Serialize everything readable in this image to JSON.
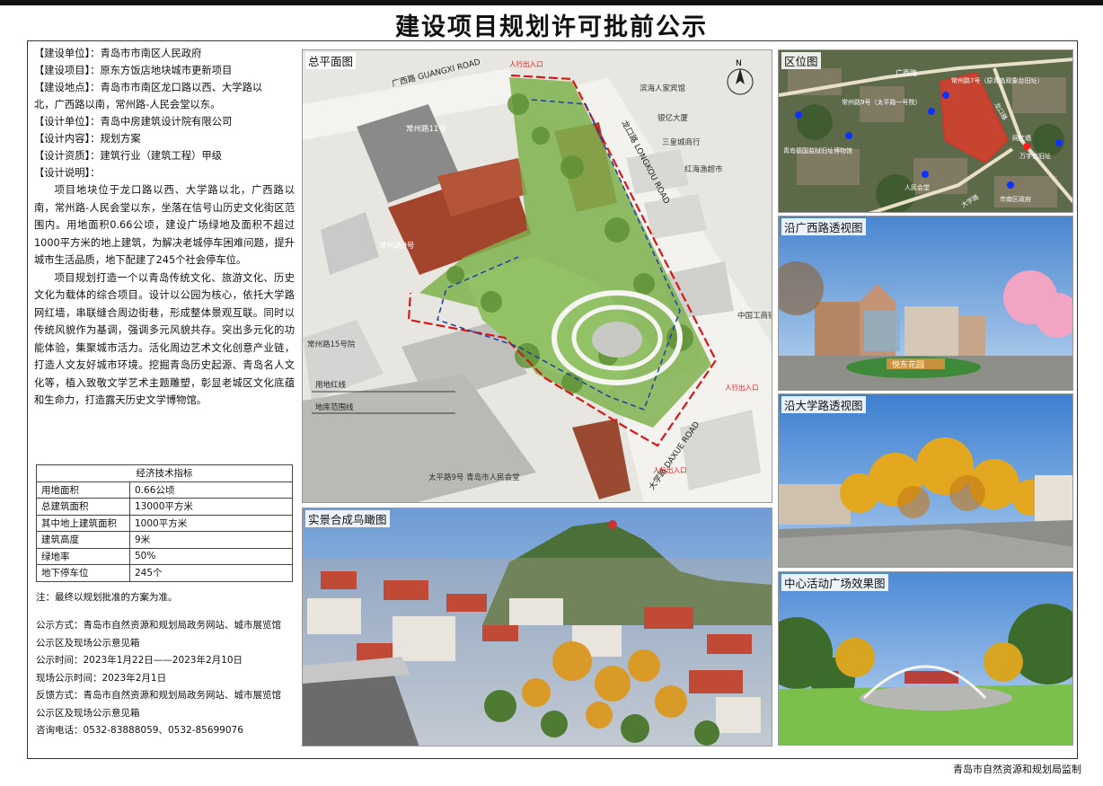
{
  "title": "建设项目规划许可批前公示",
  "info": {
    "rows": [
      {
        "label": "【建设单位】：",
        "value": "青岛市市南区人民政府"
      },
      {
        "label": "【建设项目】：",
        "value": "原东方饭店地块城市更新项目"
      },
      {
        "label": "【建设地点】：",
        "value": "青岛市市南区龙口路以西、大学路以"
      },
      {
        "label": "",
        "value": "北，广西路以南，常州路-人民会堂以东。"
      },
      {
        "label": "【设计单位】：",
        "value": "青岛中房建筑设计院有限公司"
      },
      {
        "label": "【设计内容】：",
        "value": "规划方案"
      },
      {
        "label": "【设计资质】：",
        "value": "建筑行业（建筑工程）甲级"
      },
      {
        "label": "【设计说明】：",
        "value": ""
      }
    ],
    "para1": "项目地块位于龙口路以西、大学路以北，广西路以南，常州路-人民会堂以东，坐落在信号山历史文化街区范围内。用地面积0.66公顷，建设广场绿地及面积不超过1000平方米的地上建筑，为解决老城停车困难问题，提升城市生活品质，地下配建了245个社会停车位。",
    "para2": "项目规划打造一个以青岛传统文化、旅游文化、历史文化为载体的综合项目。设计以公园为核心，依托大学路网红墙，串联缝合周边街巷，形成整体景观互联。同时以传统风貌作为基调，强调多元风貌共存。突出多元化的功能体验，集聚城市活力。活化周边艺术文化创意产业链，打造人文友好城市环境。挖掘青岛历史起源、青岛名人文化等，植入致敬文学艺术主题雕塑，彰显老城区文化底蕴和生命力，打造露天历史文学博物馆。"
  },
  "eco": {
    "header": "经济技术指标",
    "rows": [
      {
        "k": "用地面积",
        "v": "0.66公顷"
      },
      {
        "k": "总建筑面积",
        "v": "13000平方米"
      },
      {
        "k": "其中地上建筑面积",
        "v": "1000平方米"
      },
      {
        "k": "建筑高度",
        "v": "9米"
      },
      {
        "k": "绿地率",
        "v": "50%"
      },
      {
        "k": "地下停车位",
        "v": "245个"
      }
    ]
  },
  "note": "注：最终以规划批准的方案为准。",
  "publicity": {
    "lines": [
      "公示方式：青岛市自然资源和规划局政务网站、城市展览馆",
      "公示区及现场公示意见箱",
      "公示时间：2023年1月22日——2023年2月10日",
      "现场公示时间：2023年2月1日",
      "反馈方式：青岛市自然资源和规划局政务网站、城市展览馆",
      "公示区及现场公示意见箱",
      "咨询电话：0532-83888059、0532-85699076"
    ]
  },
  "panels": {
    "siteplan": "总平面图",
    "aerial": "实景合成鸟瞰图",
    "location": "区位图",
    "guangxi": "沿广西路透视图",
    "daxue": "沿大学路透视图",
    "plaza": "中心活动广场效果图"
  },
  "siteplan_labels": {
    "north": "N",
    "guangxi_road": "广西路 GUANGXI ROAD",
    "longkou_road": "龙口路 LONGKOU ROAD",
    "daxue_road": "大学路 DAXUE ROAD",
    "changzhou11": "常州路11号",
    "changzhou9": "常州路9号",
    "changzhou15": "常州路15号院",
    "binhai": "滨海人家宾馆",
    "yinyi": "银亿大厦",
    "sanhui": "三皇城商行",
    "honghai": "红海渔超市",
    "icbc": "中国工商银行",
    "renmin": "人民会堂",
    "taiping9": "太平路9号 青岛市人民会堂",
    "green_line": "用地红线",
    "boundary": "地库范围线",
    "entrance1": "人行出入口",
    "entrance2": "人行出入口",
    "entrance3": "人行出入口"
  },
  "location_labels": {
    "guangxi": "广西路",
    "changzhou7": "常州路7号（原青岛观象台旧址）",
    "changzhou9": "常州路9号（太平路一号院）",
    "museum": "青岛德国监狱旧址博物馆",
    "renmin": "人民会堂",
    "honghong": "网红墙",
    "wanzi": "万字会旧址",
    "district": "市南区政府",
    "daxue": "大学路",
    "longkou": "龙口路"
  },
  "render_labels": {
    "guangxi_sign": "悦东花园"
  },
  "footer": "青岛市自然资源和规划局监制",
  "colors": {
    "redline": "#d81818",
    "boundary": "#1f3fa8",
    "roof": "#a3452c",
    "green": "#7fb24e"
  }
}
